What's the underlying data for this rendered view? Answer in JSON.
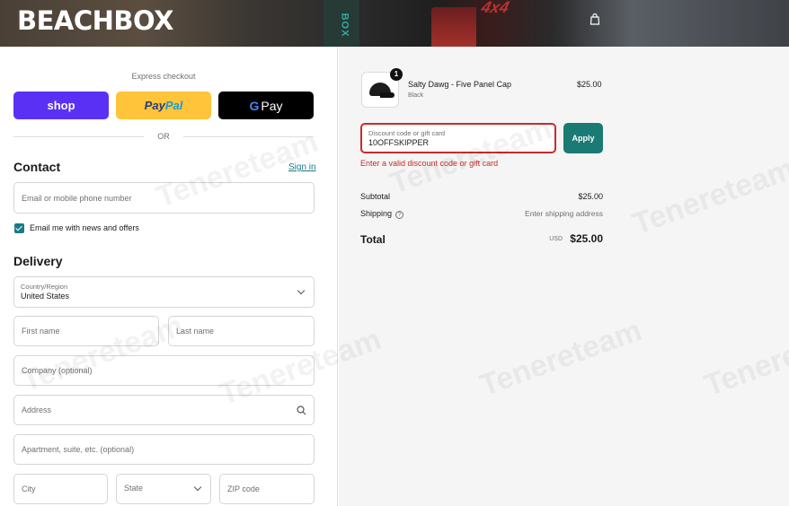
{
  "header": {
    "logo": "BEACHBOX",
    "truck_box_text": "BOX",
    "truck_badge": "4x4"
  },
  "express": {
    "label": "Express checkout",
    "shop_label": "shop",
    "paypal_part1": "Pay",
    "paypal_part2": "Pal",
    "gpay_g": "G",
    "gpay_label": "Pay",
    "or_label": "OR"
  },
  "contact": {
    "title": "Contact",
    "signin": "Sign in",
    "email_placeholder": "Email or mobile phone number",
    "newsletter_label": "Email me with news and offers"
  },
  "delivery": {
    "title": "Delivery",
    "country_label": "Country/Region",
    "country_value": "United States",
    "first_name": "First name",
    "last_name": "Last name",
    "company": "Company (optional)",
    "address": "Address",
    "apartment": "Apartment, suite, etc. (optional)",
    "city": "City",
    "state": "State",
    "zip": "ZIP code"
  },
  "order": {
    "qty": "1",
    "product_name": "Salty Dawg - Five Panel Cap",
    "variant": "Black",
    "price": "$25.00"
  },
  "discount": {
    "label": "Discount code or gift card",
    "value": "10OFFSKIPPER",
    "apply": "Apply",
    "error": "Enter a valid discount code or gift card"
  },
  "summary": {
    "subtotal_label": "Subtotal",
    "subtotal_value": "$25.00",
    "shipping_label": "Shipping",
    "shipping_value": "Enter shipping address",
    "total_label": "Total",
    "currency": "USD",
    "total_value": "$25.00"
  },
  "watermark": "Tenereteam",
  "colors": {
    "accent": "#1a7a86",
    "error": "#cc2a2a",
    "shop": "#5a31f4",
    "paypal": "#ffc439"
  }
}
